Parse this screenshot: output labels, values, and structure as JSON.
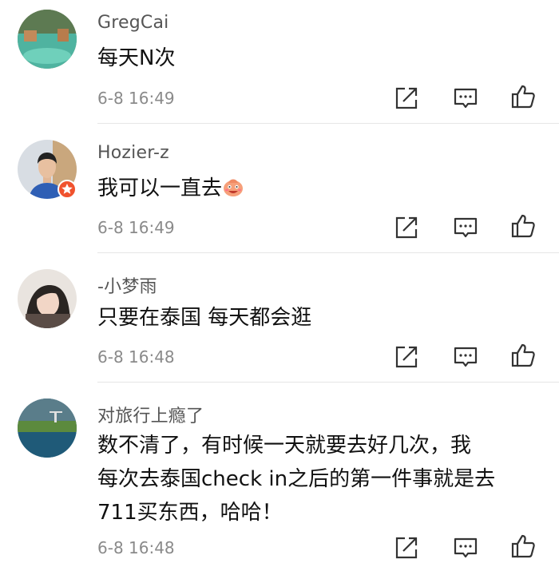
{
  "comments": [
    {
      "username": "GregCai",
      "text": "每天N次",
      "time": "6-8 16:49",
      "verified": false,
      "avatar": "pool-landscape"
    },
    {
      "username": "Hozier-z",
      "text": "我可以一直去",
      "emoji": "smiling-face-emoji",
      "time": "6-8 16:49",
      "verified": true,
      "avatar": "man-portrait"
    },
    {
      "username": "-小梦雨",
      "text": "只要在泰国 每天都会逛",
      "time": "6-8 16:48",
      "verified": false,
      "avatar": "woman-portrait"
    },
    {
      "username": "对旅行上瘾了",
      "text_lines": [
        "数不清了，有时候一天就要去好几次，我",
        "每次去泰国check in之后的第一件事就是去",
        "711买东西，哈哈！"
      ],
      "time": "6-8 16:48",
      "verified": false,
      "avatar": "lake-scenery"
    }
  ],
  "actions": [
    {
      "icon": "share-icon"
    },
    {
      "icon": "comment-icon"
    },
    {
      "icon": "like-icon"
    }
  ],
  "colors": {
    "badge": "#f0522d",
    "time": "#8a8a8a",
    "username": "#555555"
  }
}
